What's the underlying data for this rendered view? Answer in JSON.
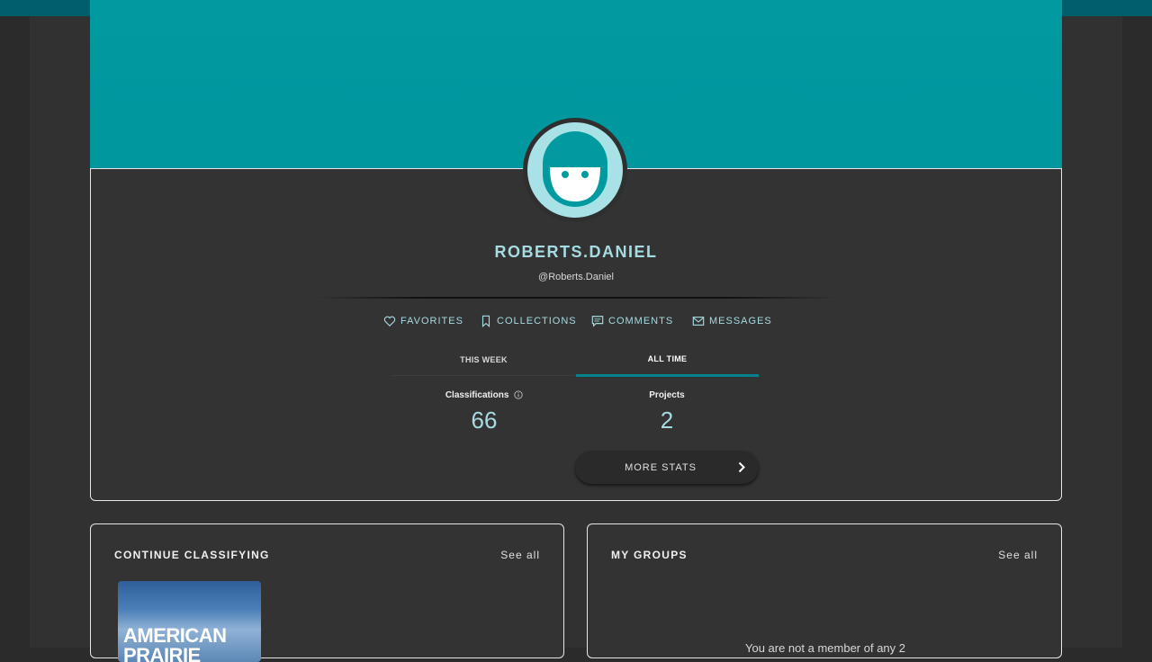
{
  "profile": {
    "display_name": "ROBERTS.DANIEL",
    "handle": "@Roberts.Daniel"
  },
  "nav": {
    "favorites": "FAVORITES",
    "collections": "COLLECTIONS",
    "comments": "COMMENTS",
    "messages": "MESSAGES"
  },
  "stats": {
    "tabs": {
      "week": "THIS WEEK",
      "all_time": "ALL TIME",
      "selected": "all_time"
    },
    "classifications_label": "Classifications",
    "classifications_value": "66",
    "projects_label": "Projects",
    "projects_value": "2",
    "more_stats_label": "MORE STATS"
  },
  "continue_classifying": {
    "title": "CONTINUE CLASSIFYING",
    "see_all": "See all",
    "thumb_text": "AMERICAN PRAIRIE"
  },
  "my_groups": {
    "title": "MY GROUPS",
    "see_all": "See all",
    "empty_message": "You are not a member of any 2"
  },
  "colors": {
    "banner": "#009aa0",
    "accent": "#a6dbe2",
    "tab_underline": "#00838c",
    "background": "#313131"
  },
  "icons": {
    "favorites": "heart-icon",
    "collections": "bookmark-icon",
    "comments": "comment-icon",
    "messages": "envelope-icon",
    "info": "info-icon",
    "more_stats": "chevron-right-icon"
  }
}
